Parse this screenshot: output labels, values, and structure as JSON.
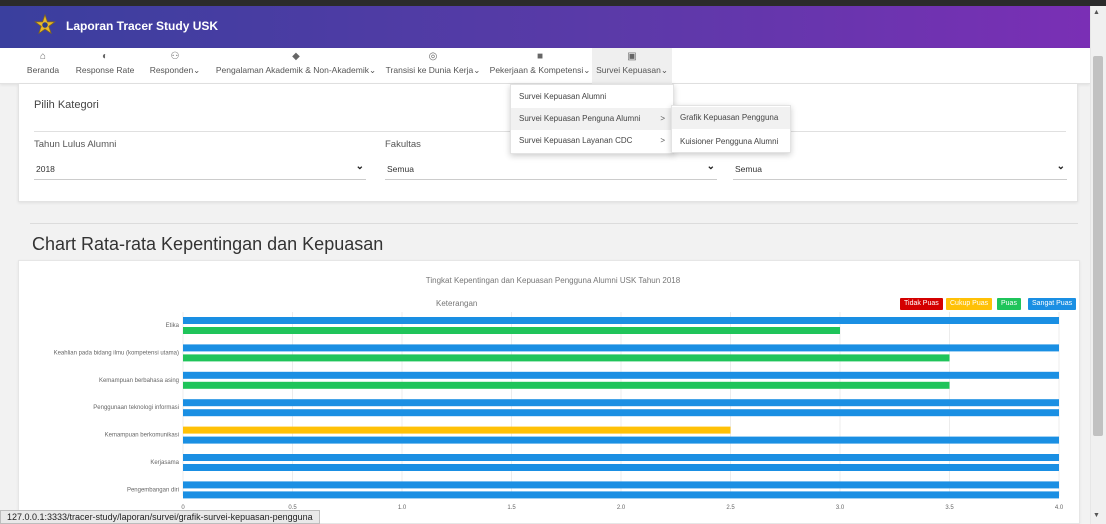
{
  "app": {
    "title": "Laporan Tracer Study USK",
    "logo": "usk-star-logo"
  },
  "nav": [
    {
      "label": "Beranda",
      "icon": "home-icon",
      "glyph": "⌂",
      "caret": ""
    },
    {
      "label": "Response Rate",
      "icon": "pie-chart-icon",
      "glyph": "◐",
      "caret": ""
    },
    {
      "label": "Responden",
      "icon": "users-icon",
      "glyph": "⚇",
      "caret": "⌄"
    },
    {
      "label": "Pengalaman Akademik & Non-Akademik",
      "icon": "graduation-cap-icon",
      "glyph": "◆",
      "caret": "⌄"
    },
    {
      "label": "Transisi ke Dunia Kerja",
      "icon": "globe-icon",
      "glyph": "◎",
      "caret": "⌄"
    },
    {
      "label": "Pekerjaan & Kompetensi",
      "icon": "briefcase-icon",
      "glyph": "■",
      "caret": "⌄"
    },
    {
      "label": "Survei Kepuasan",
      "icon": "chart-icon",
      "glyph": "▣",
      "caret": "⌄"
    }
  ],
  "dropdown": {
    "items": [
      {
        "label": "Survei Kepuasan Alumni",
        "arrow": ""
      },
      {
        "label": "Survei Kepuasan Penguna Alumni",
        "arrow": ">"
      },
      {
        "label": "Survei Kepuasan Layanan CDC",
        "arrow": ">"
      }
    ],
    "submenu": [
      "Grafik Kepuasan Pengguna",
      "Kuisioner Pengguna Alumni"
    ]
  },
  "filters": {
    "section_label": "Pilih Kategori",
    "tahun": {
      "label": "Tahun Lulus Alumni",
      "value": "2018"
    },
    "fakultas": {
      "label": "Fakultas",
      "value": "Semua"
    },
    "prodi": {
      "value": "Semua"
    }
  },
  "section_title": "Chart Rata-rata Kepentingan dan Kepuasan",
  "chart_data": {
    "type": "bar",
    "orientation": "horizontal",
    "title": "Tingkat Kepentingan dan Kepuasan Pengguna Alumni USK Tahun 2018",
    "legend_title": "Keterangan",
    "legend": [
      {
        "label": "Tidak Puas",
        "color": "#d40000"
      },
      {
        "label": "Cukup Puas",
        "color": "#ffc107"
      },
      {
        "label": "Puas",
        "color": "#1fc45a"
      },
      {
        "label": "Sangat Puas",
        "color": "#1a8fe3"
      }
    ],
    "categories": [
      "Etika",
      "Keahlian pada bidang ilmu (kompetensi utama)",
      "Kemampuan berbahasa asing",
      "Penggunaan teknologi informasi",
      "Kemampuan berkomunikasi",
      "Kerjasama",
      "Pengembangan diri"
    ],
    "series": [
      {
        "values": [
          4.0,
          4.0,
          4.0,
          4.0,
          2.5,
          4.0,
          4.0
        ],
        "colors": [
          "#1a8fe3",
          "#1a8fe3",
          "#1a8fe3",
          "#1a8fe3",
          "#ffc107",
          "#1a8fe3",
          "#1a8fe3"
        ]
      },
      {
        "values": [
          3.0,
          3.5,
          3.5,
          4.0,
          4.0,
          4.0,
          4.0
        ],
        "colors": [
          "#1fc45a",
          "#1fc45a",
          "#1fc45a",
          "#1a8fe3",
          "#1a8fe3",
          "#1a8fe3",
          "#1a8fe3"
        ]
      }
    ],
    "xlim": [
      0,
      4.0
    ],
    "xticks": [
      "0",
      "0.5",
      "1.0",
      "1.5",
      "2.0",
      "2.5",
      "3.0",
      "3.5",
      "4.0"
    ],
    "grid": true
  },
  "status_url": "127.0.0.1:3333/tracer-study/laporan/survei/grafik-survei-kepuasan-pengguna"
}
